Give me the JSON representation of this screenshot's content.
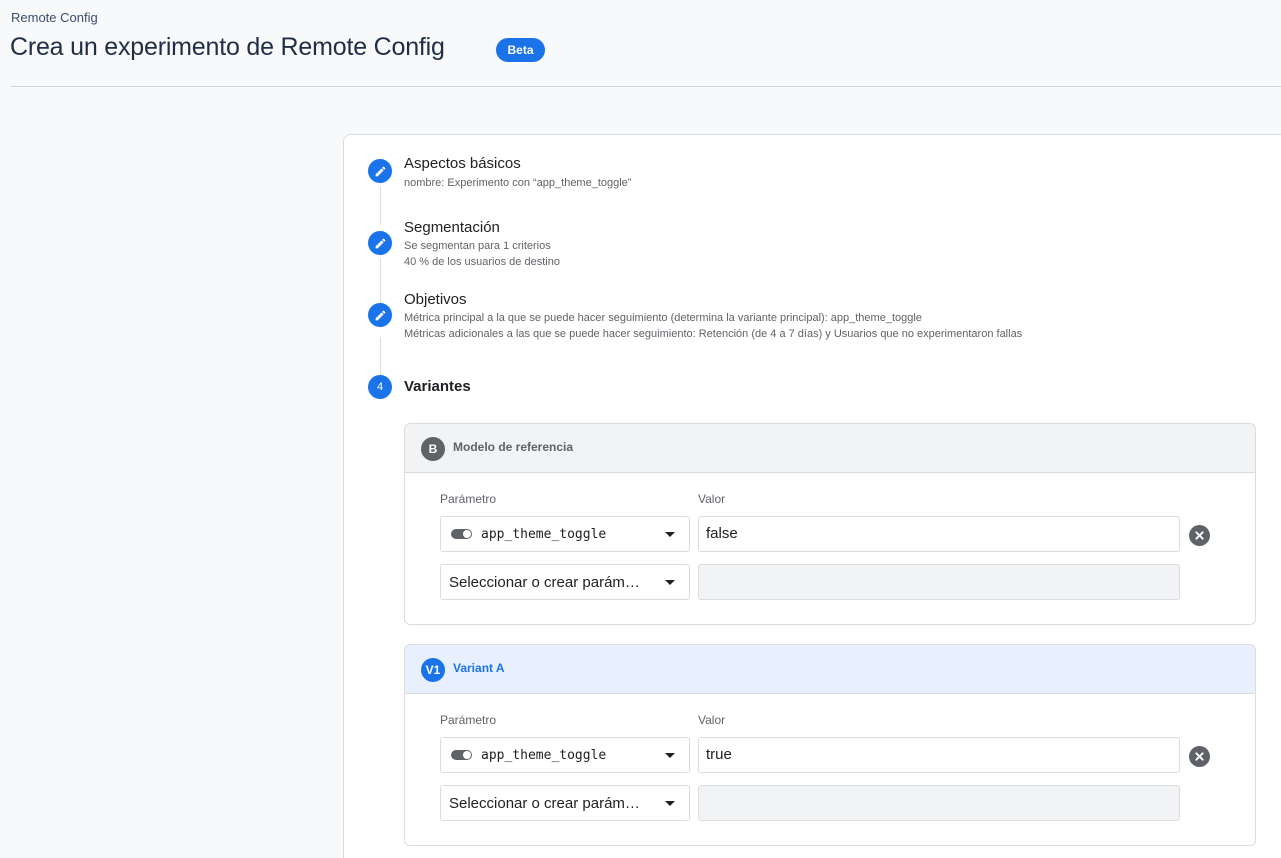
{
  "breadcrumb": "Remote Config",
  "title": "Crea un experimento de Remote Config",
  "badge": "Beta",
  "steps": [
    {
      "title": "Aspectos básicos",
      "lines": [
        "nombre: Experimento con “app_theme_toggle”"
      ]
    },
    {
      "title": "Segmentación",
      "lines": [
        "Se segmentan para 1 criterios",
        "40 % de los usuarios de destino"
      ]
    },
    {
      "title": "Objetivos",
      "lines": [
        "Métrica principal a la que se puede hacer seguimiento (determina la variante principal): app_theme_toggle",
        "Métricas adicionales a las que se puede hacer seguimiento: Retención (de 4 a 7 días) y Usuarios que no experimentaron fallas"
      ]
    },
    {
      "number": "4",
      "title": "Variantes"
    }
  ],
  "variants": [
    {
      "badge": "B",
      "name": "Modelo de referencia",
      "param_label": "Parámetro",
      "value_label": "Valor",
      "param": "app_theme_toggle",
      "value": "false",
      "new_param_placeholder": "Seleccionar o crear parám…"
    },
    {
      "badge": "V1",
      "name": "Variant A",
      "param_label": "Parámetro",
      "value_label": "Valor",
      "param": "app_theme_toggle",
      "value": "true",
      "new_param_placeholder": "Seleccionar o crear parám…"
    }
  ],
  "colors": {
    "accent": "#1a73e8",
    "grey_badge": "#5f6368"
  }
}
